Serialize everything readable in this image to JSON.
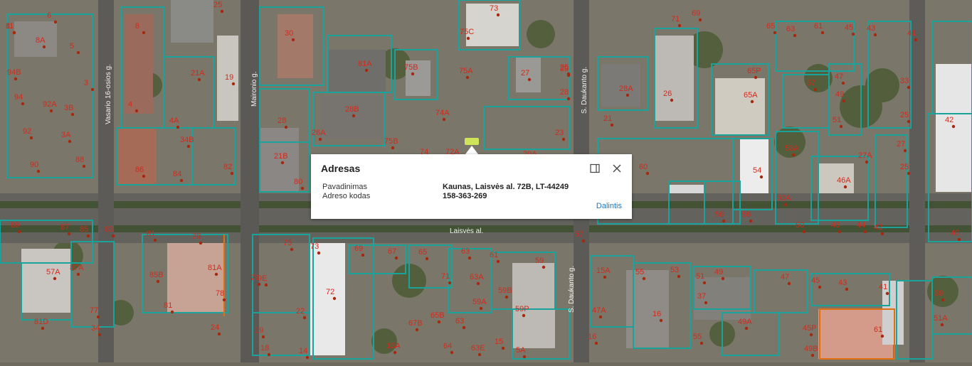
{
  "map": {
    "streets": [
      "Vasario 16-osios g.",
      "Maironio g.",
      "S. Daukanto g.",
      "S. Daukanto g.",
      "Laisvės al."
    ],
    "parcel_labels": [
      "8",
      "6",
      "8A",
      "5",
      "8",
      "94B",
      "94",
      "92A",
      "3B",
      "3",
      "4",
      "92",
      "4A",
      "34B",
      "3A",
      "88",
      "90",
      "86",
      "84",
      "82",
      "25",
      "30",
      "19",
      "21A",
      "81A",
      "75B",
      "73",
      "75C",
      "75A",
      "74A",
      "28B",
      "28",
      "26A",
      "75B",
      "74",
      "72A",
      "20A",
      "80",
      "21B",
      "71",
      "69",
      "65",
      "63",
      "61",
      "45",
      "43",
      "41",
      "65P",
      "65A",
      "57",
      "47",
      "49",
      "33",
      "51",
      "25",
      "42",
      "27",
      "29",
      "28",
      "28A",
      "26",
      "21",
      "23",
      "25",
      "60",
      "53A",
      "27A",
      "27",
      "25",
      "54",
      "46A",
      "50A",
      "50",
      "46",
      "44",
      "42",
      "40",
      "58",
      "56",
      "89",
      "87",
      "85",
      "83",
      "81",
      "79",
      "75",
      "73",
      "69",
      "67",
      "65",
      "63",
      "61",
      "59",
      "57",
      "57A",
      "87A",
      "85B",
      "81A",
      "77",
      "81",
      "78",
      "79",
      "72",
      "71",
      "63A",
      "59B",
      "59A",
      "59P",
      "15A",
      "55",
      "53",
      "51",
      "49",
      "47",
      "45",
      "43",
      "41",
      "39",
      "37",
      "49A",
      "47A",
      "16",
      "51A",
      "34",
      "81D",
      "67B",
      "65B",
      "63",
      "61",
      "19",
      "18",
      "16",
      "14",
      "13A",
      "64",
      "63E",
      "55",
      "49B",
      "45P",
      "5A",
      "15",
      "9E",
      "22",
      "24",
      "11"
    ],
    "popup": {
      "title": "Adresas",
      "rows": [
        {
          "label": "Pavadinimas",
          "value": "Kaunas, Laisvės al. 72B, LT-44249"
        },
        {
          "label": "Adreso kodas",
          "value": "158-363-269"
        }
      ],
      "share": "Dalintis",
      "maximize_icon": "square-maximize-icon",
      "close_icon": "close-icon"
    }
  }
}
